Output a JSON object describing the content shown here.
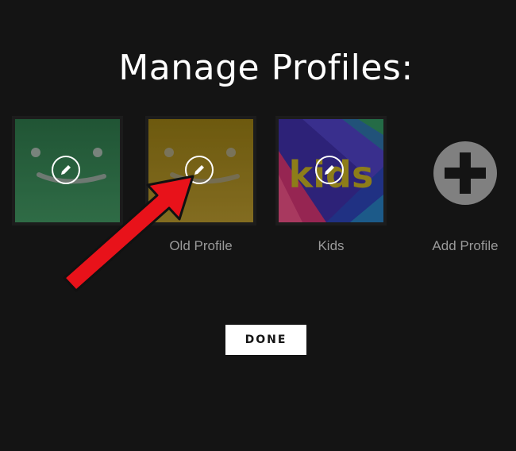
{
  "page": {
    "title": "Manage Profiles:",
    "done_label": "DONE"
  },
  "profiles": [
    {
      "name": "",
      "color": "#2f7f4e",
      "type": "smiley",
      "edit_icon": "pencil-icon"
    },
    {
      "name": "Old Profile",
      "color": "#9d8118",
      "type": "smiley",
      "edit_icon": "pencil-icon"
    },
    {
      "name": "Kids",
      "color": "#5a2a9a",
      "type": "kids",
      "avatar_text": "kids",
      "edit_icon": "pencil-icon"
    }
  ],
  "add_profile": {
    "label": "Add Profile",
    "icon": "plus-icon"
  },
  "annotation": {
    "type": "red-arrow",
    "color": "#e8121a"
  }
}
